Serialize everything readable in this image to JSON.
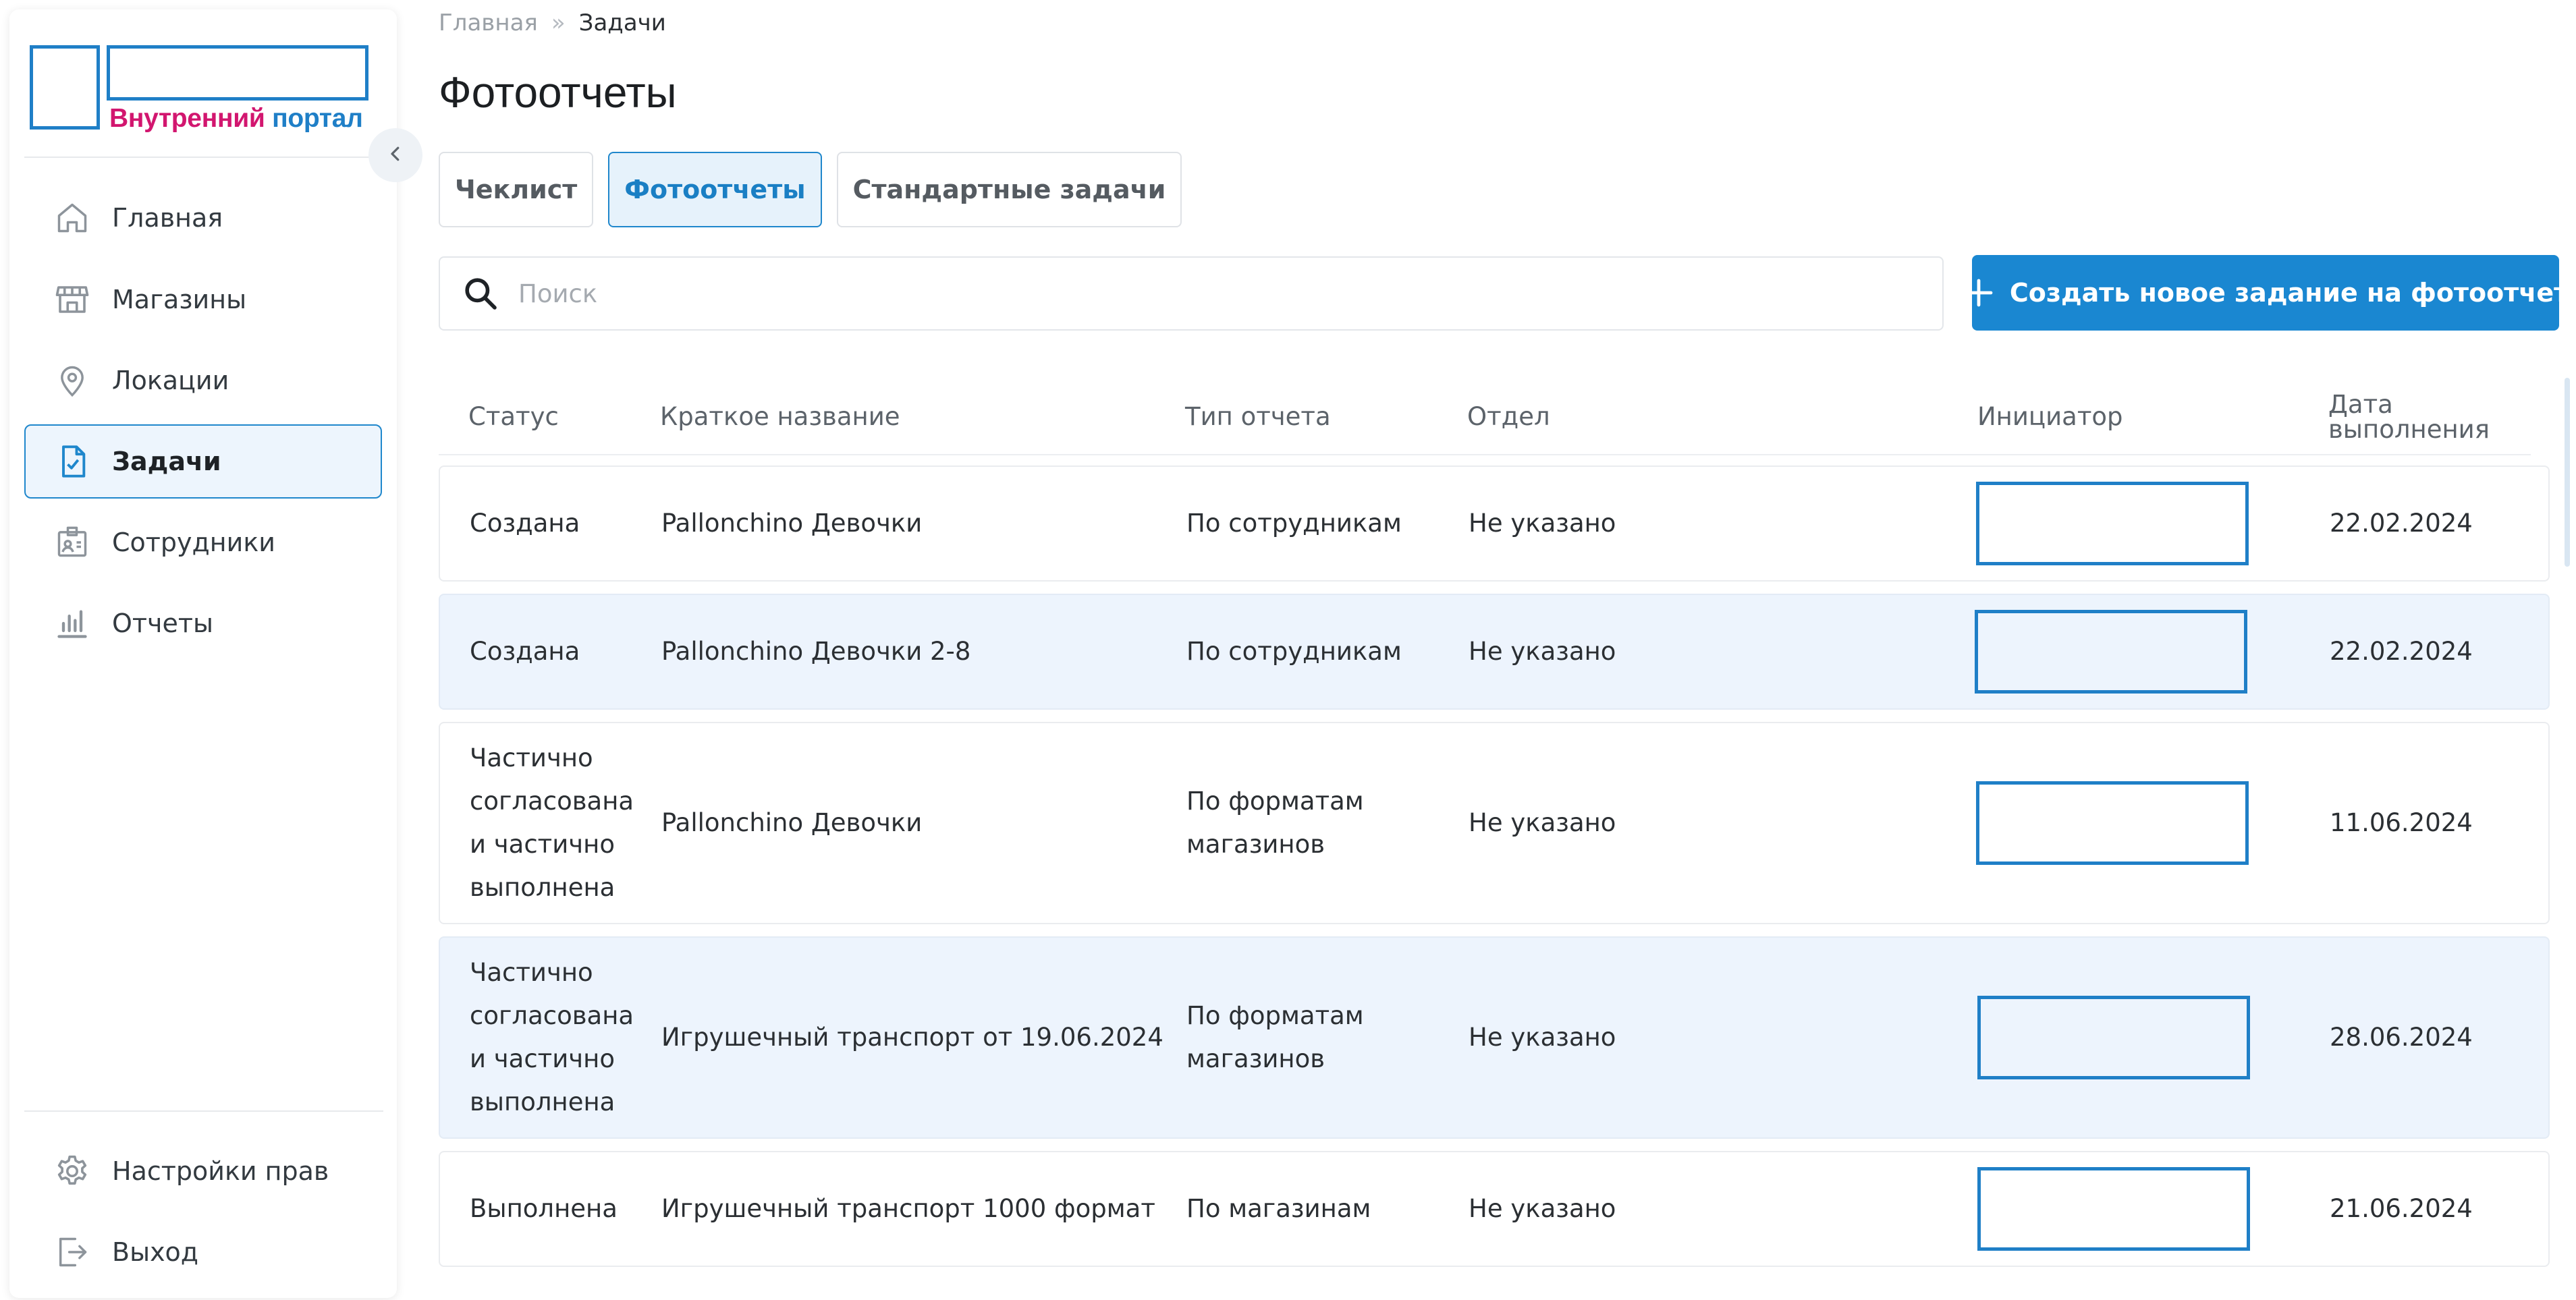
{
  "brand": {
    "name_part1": "Внутренний",
    "name_part2": "портал",
    "color_primary": "#1f7fc7",
    "color_accent": "#d2166f"
  },
  "sidebar": {
    "items": [
      {
        "label": "Главная",
        "icon": "home-icon"
      },
      {
        "label": "Магазины",
        "icon": "store-icon"
      },
      {
        "label": "Локации",
        "icon": "location-pin-icon"
      },
      {
        "label": "Задачи",
        "icon": "task-check-icon",
        "active": true
      },
      {
        "label": "Сотрудники",
        "icon": "id-badge-icon"
      },
      {
        "label": "Отчеты",
        "icon": "bar-chart-icon"
      }
    ],
    "bottom_items": [
      {
        "label": "Настройки прав",
        "icon": "gear-icon"
      },
      {
        "label": "Выход",
        "icon": "logout-icon"
      }
    ]
  },
  "breadcrumb": {
    "home": "Главная",
    "separator": "»",
    "current": "Задачи"
  },
  "page": {
    "title": "Фотоотчеты"
  },
  "tabs": [
    {
      "label": "Чеклист"
    },
    {
      "label": "Фотоотчеты",
      "active": true
    },
    {
      "label": "Стандартные задачи"
    }
  ],
  "search": {
    "placeholder": "Поиск",
    "value": ""
  },
  "actions": {
    "create_label": "Создать новое задание на фотоотчет"
  },
  "table": {
    "columns": [
      "Статус",
      "Краткое название",
      "Тип отчета",
      "Отдел",
      "Инициатор",
      "Дата выполнения"
    ],
    "rows": [
      {
        "status": "Создана",
        "name": "Pallonchino Девочки",
        "type": "По сотрудникам",
        "department": "Не указано",
        "date": "22.02.2024"
      },
      {
        "status": "Создана",
        "name": "Pallonchino Девочки 2-8",
        "type": "По сотрудникам",
        "department": "Не указано",
        "date": "22.02.2024"
      },
      {
        "status": "Частично согласована и частично выполнена",
        "name": "Pallonchino Девочки",
        "type": "По форматам магазинов",
        "department": "Не указано",
        "date": "11.06.2024"
      },
      {
        "status": "Частично согласована и частично выполнена",
        "name": "Игрушечный транспорт от 19.06.2024",
        "type": "По форматам магазинов",
        "department": "Не указано",
        "date": "28.06.2024"
      },
      {
        "status": "Выполнена",
        "name": "Игрушечный транспорт 1000 формат",
        "type": "По магазинам",
        "department": "Не указано",
        "date": "21.06.2024"
      }
    ]
  }
}
